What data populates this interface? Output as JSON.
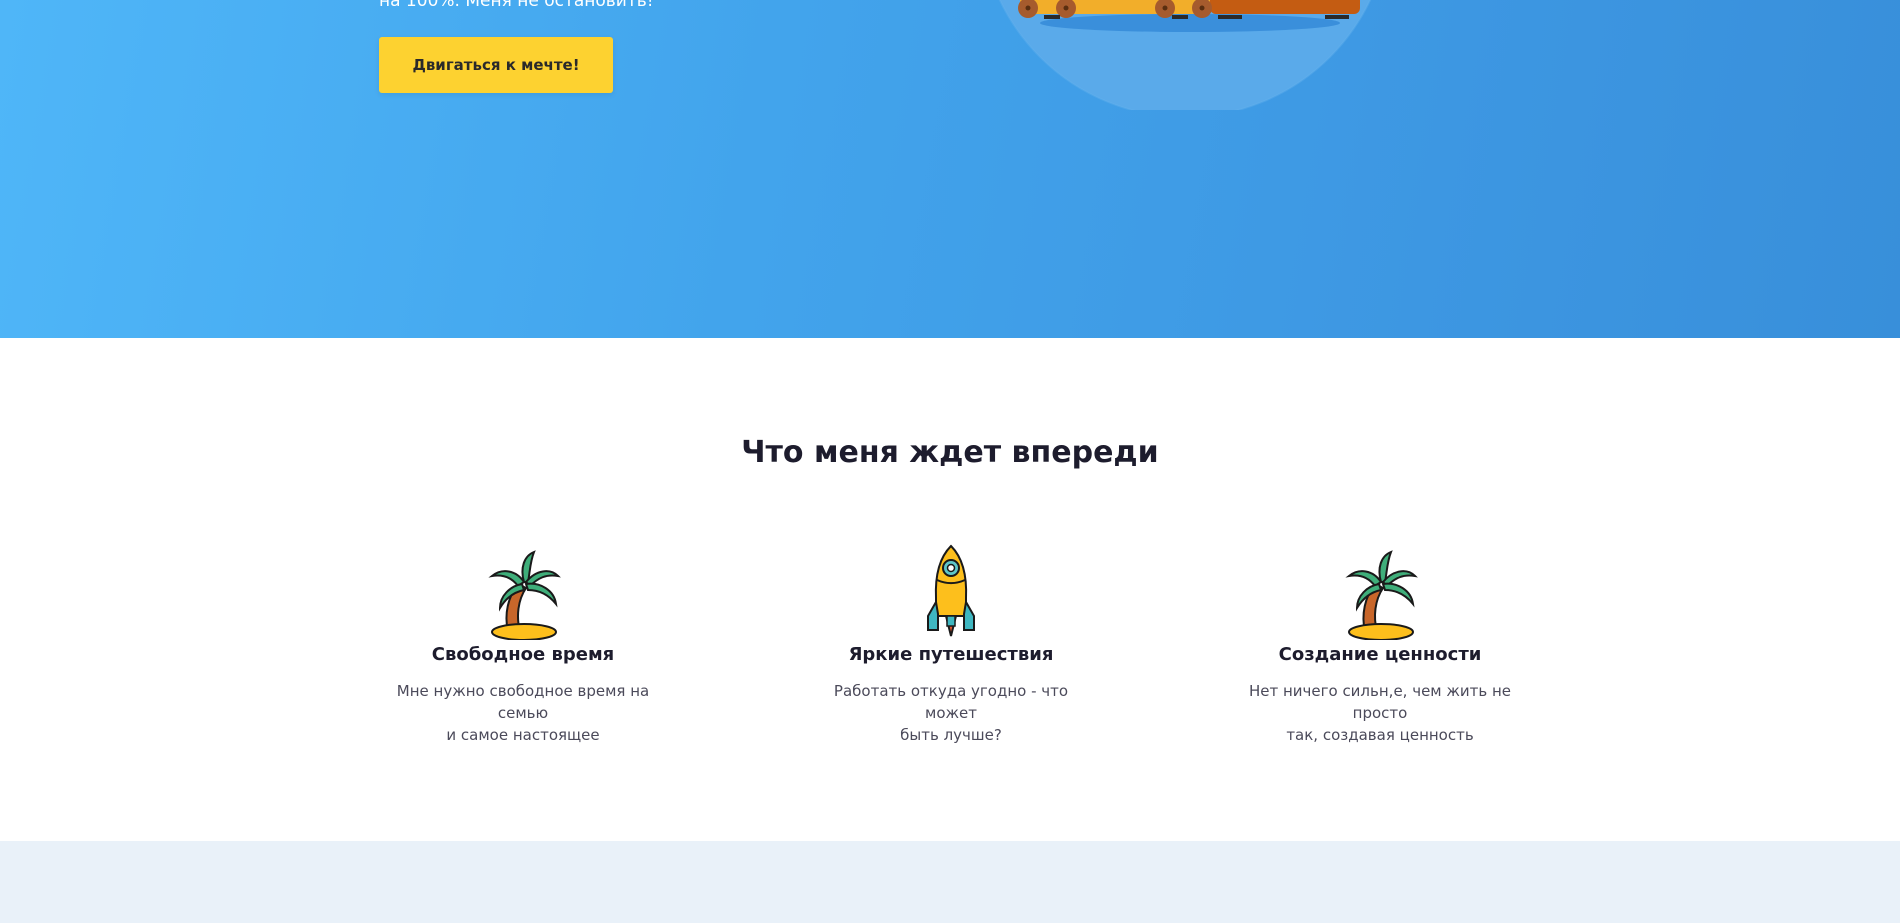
{
  "hero": {
    "text_line": "на 100%. Меня не остановить!",
    "cta_label": "Двигаться к мечте!"
  },
  "section": {
    "title": "Что меня ждет впереди"
  },
  "features": [
    {
      "icon": "palm-island-icon",
      "title": "Свободное время",
      "desc_line1": "Мне нужно свободное время на семью",
      "desc_line2": "и самое настоящее"
    },
    {
      "icon": "rocket-icon",
      "title": "Яркие путешествия",
      "desc_line1": "Работать откуда угодно - что может",
      "desc_line2": "быть лучше?"
    },
    {
      "icon": "palm-island-icon",
      "title": "Создание ценности",
      "desc_line1": "Нет ничего сильн,е, чем жить не просто",
      "desc_line2": "так, создавая ценность"
    }
  ],
  "colors": {
    "hero_gradient_start": "#4fb6f8",
    "hero_gradient_end": "#388fda",
    "button_yellow": "#fdd230",
    "heading_dark": "#1d1c2d",
    "bottom_band": "#e9f1f9"
  }
}
